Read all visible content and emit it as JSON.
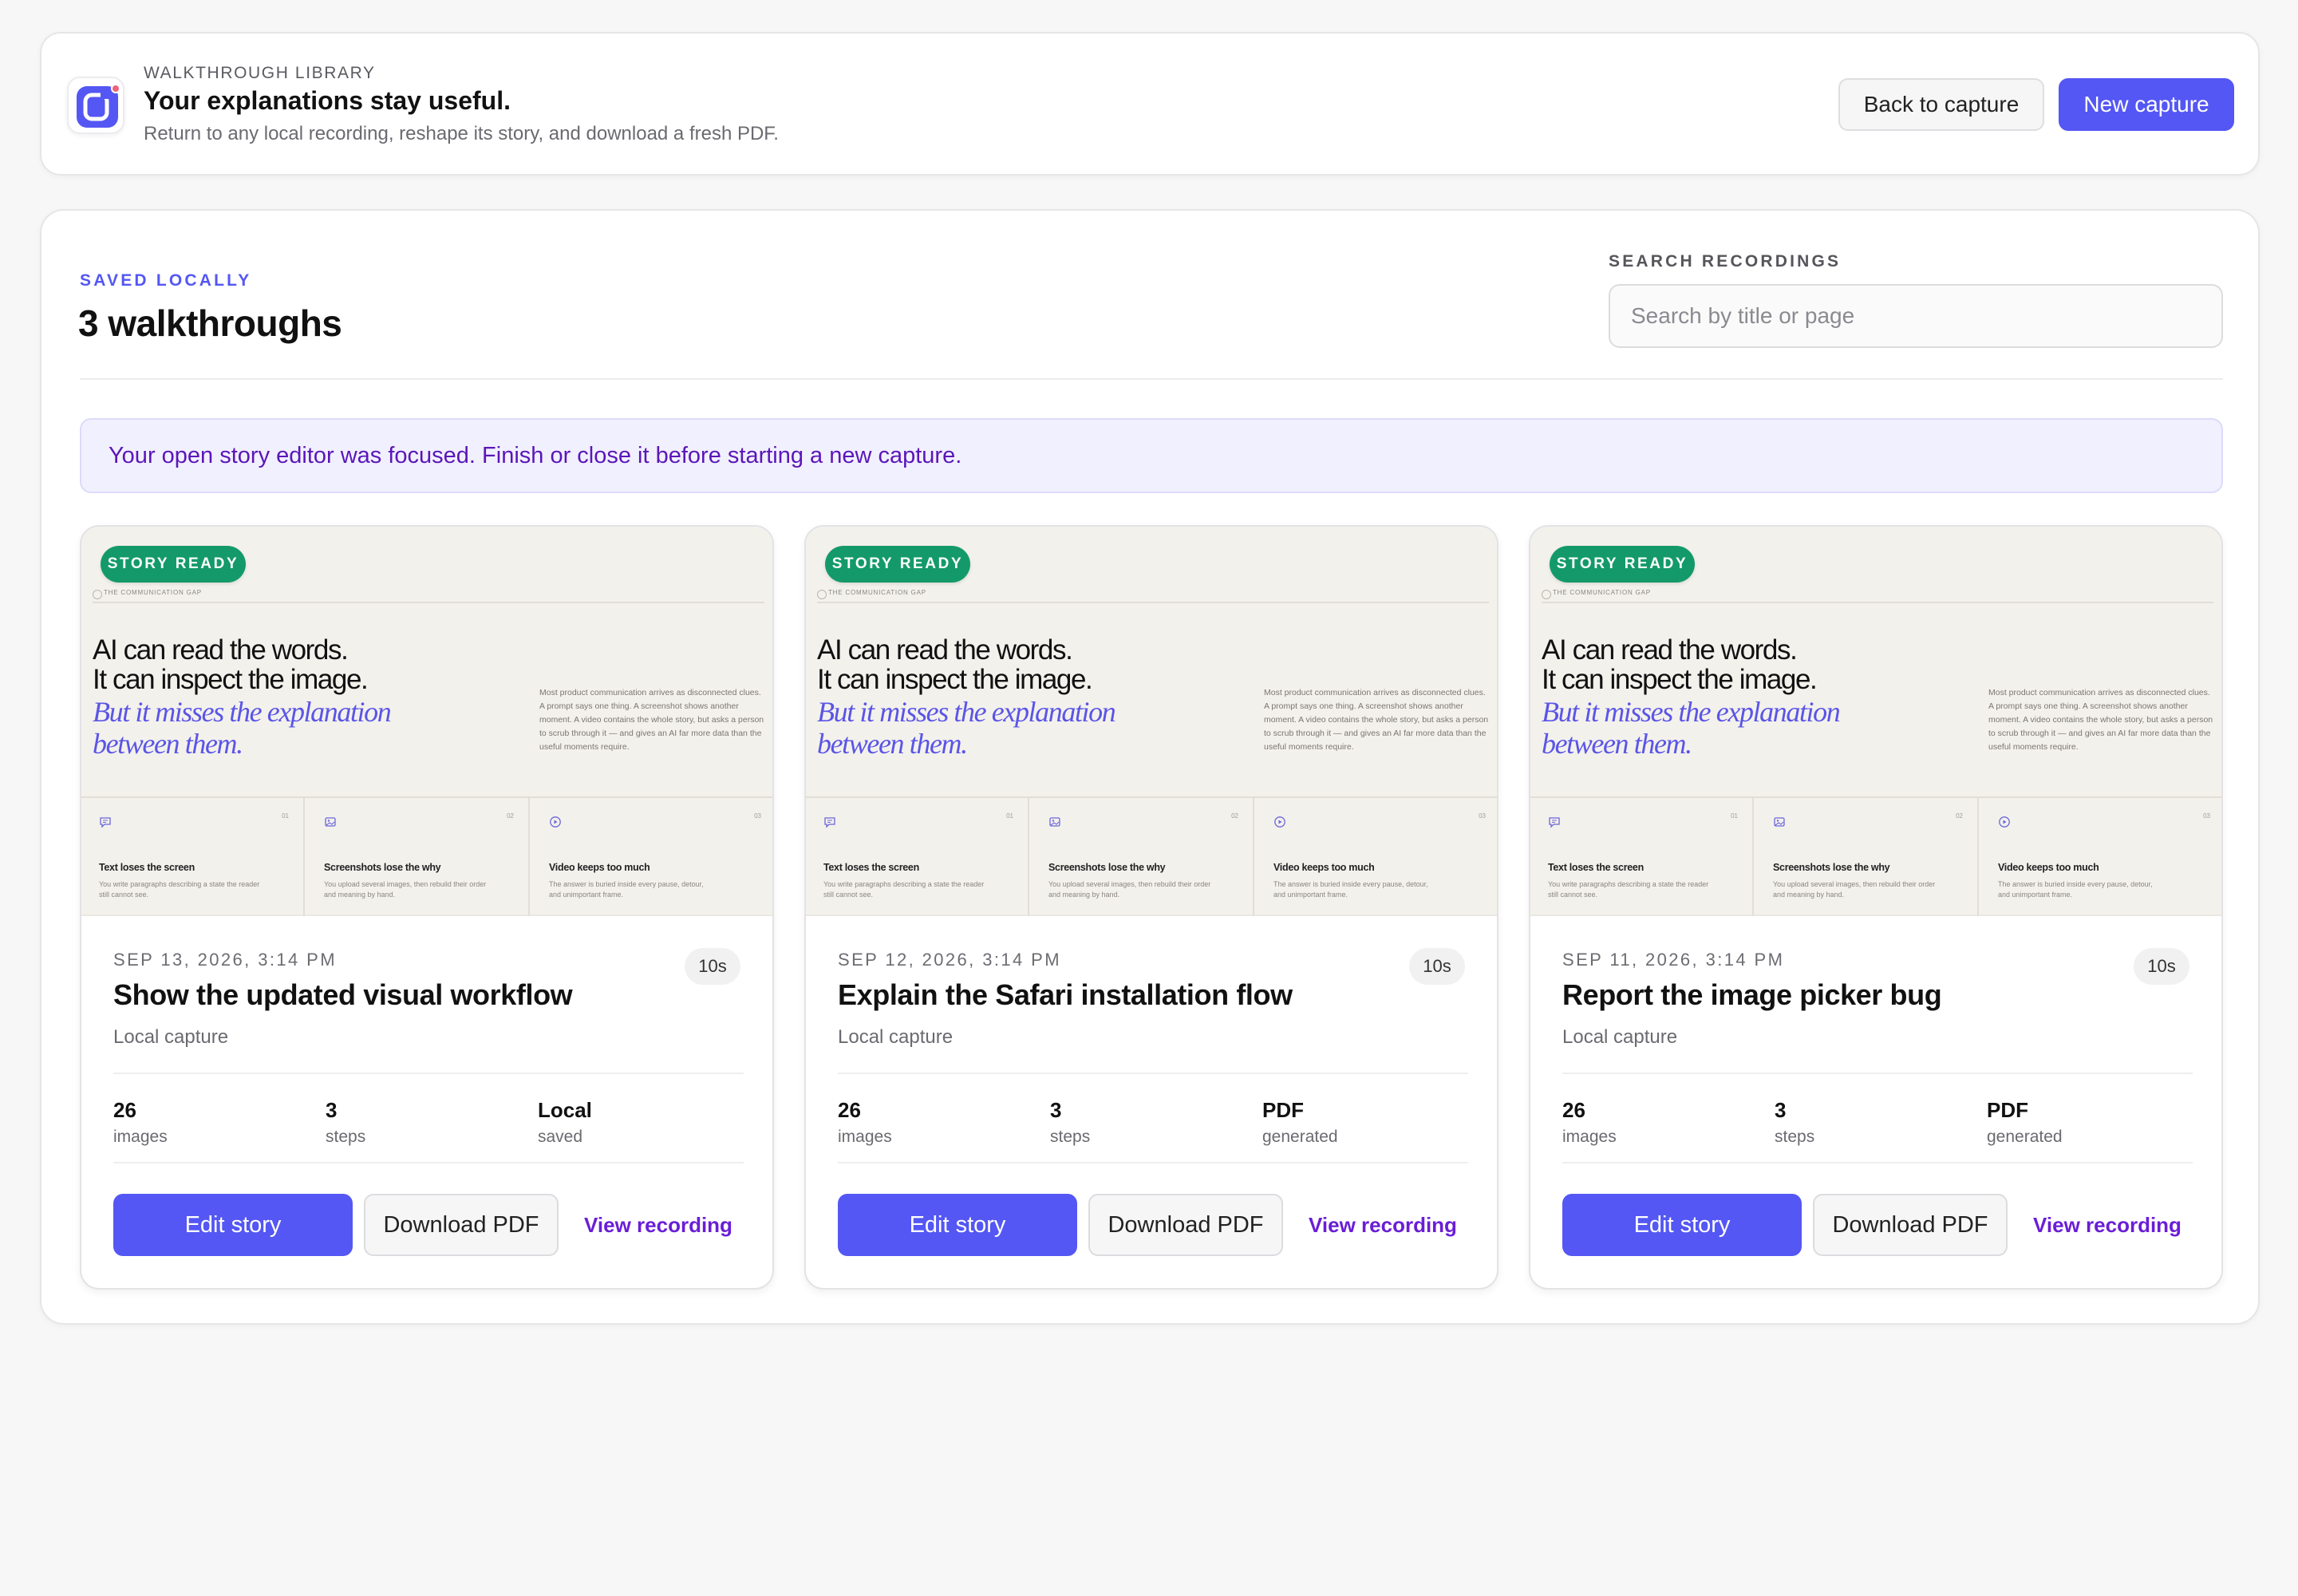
{
  "header": {
    "eyebrow": "WALKTHROUGH LIBRARY",
    "title": "Your explanations stay useful.",
    "subtitle": "Return to any local recording, reshape its story, and download a fresh PDF.",
    "back_label": "Back to capture",
    "new_label": "New capture",
    "logo_icon": "capture-app-logo-icon",
    "accent": "#5457f3"
  },
  "library": {
    "eyebrow": "SAVED LOCALLY",
    "title": "3 walkthroughs",
    "search_label": "SEARCH RECORDINGS",
    "search_placeholder": "Search by title or page",
    "search_value": "",
    "notice": "Your open story editor was focused. Finish or close it before starting a new capture."
  },
  "thumbnail": {
    "badge": "STORY READY",
    "tag": "THE COMMUNICATION GAP",
    "heading_line1": "AI can read the words.",
    "heading_line2": "It can inspect the image.",
    "heading_em": "But it misses the explanation between them.",
    "paragraph": "Most product communication arrives as disconnected clues. A prompt says one thing. A screenshot shows another moment. A video contains the whole story, but asks a person to scrub through it — and gives an AI far more data than the useful moments require.",
    "columns": [
      {
        "icon": "chat-icon",
        "num": "01",
        "title": "Text loses the screen",
        "text": "You write paragraphs describing a state the reader still cannot see."
      },
      {
        "icon": "image-icon",
        "num": "02",
        "title": "Screenshots lose the why",
        "text": "You upload several images, then rebuild their order and meaning by hand."
      },
      {
        "icon": "play-icon",
        "num": "03",
        "title": "Video keeps too much",
        "text": "The answer is buried inside every pause, detour, and unimportant frame."
      }
    ]
  },
  "cards": [
    {
      "date": "SEP 13, 2026, 3:14 PM",
      "duration": "10s",
      "title": "Show the updated visual workflow",
      "subtitle": "Local capture",
      "stats": [
        {
          "value": "26",
          "label": "images"
        },
        {
          "value": "3",
          "label": "steps"
        },
        {
          "value": "Local",
          "label": "saved"
        }
      ],
      "edit_label": "Edit story",
      "pdf_label": "Download PDF",
      "view_label": "View recording"
    },
    {
      "date": "SEP 12, 2026, 3:14 PM",
      "duration": "10s",
      "title": "Explain the Safari installation flow",
      "subtitle": "Local capture",
      "stats": [
        {
          "value": "26",
          "label": "images"
        },
        {
          "value": "3",
          "label": "steps"
        },
        {
          "value": "PDF",
          "label": "generated"
        }
      ],
      "edit_label": "Edit story",
      "pdf_label": "Download PDF",
      "view_label": "View recording"
    },
    {
      "date": "SEP 11, 2026, 3:14 PM",
      "duration": "10s",
      "title": "Report the image picker bug",
      "subtitle": "Local capture",
      "stats": [
        {
          "value": "26",
          "label": "images"
        },
        {
          "value": "3",
          "label": "steps"
        },
        {
          "value": "PDF",
          "label": "generated"
        }
      ],
      "edit_label": "Edit story",
      "pdf_label": "Download PDF",
      "view_label": "View recording"
    }
  ]
}
